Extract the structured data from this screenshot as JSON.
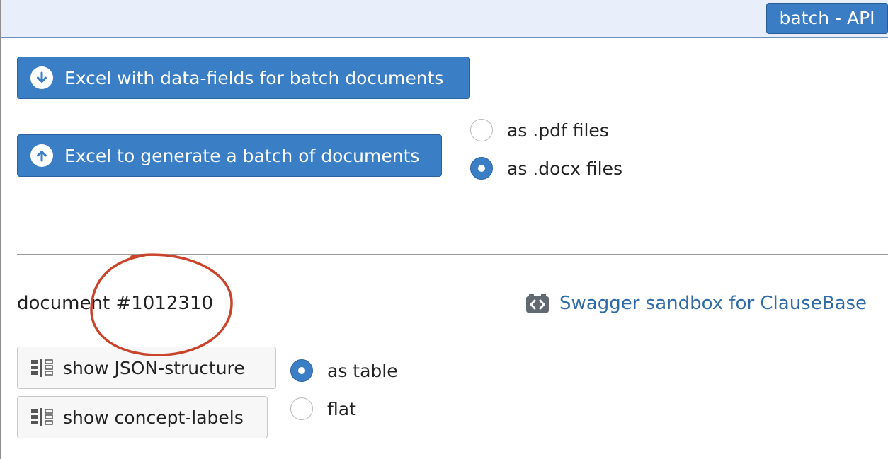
{
  "header": {
    "tab_label": "batch - API"
  },
  "batch": {
    "download_button_label": "Excel with data-fields for batch documents",
    "upload_button_label": "Excel to generate a batch of documents",
    "format_options": [
      {
        "label": "as .pdf files",
        "checked": false
      },
      {
        "label": "as .docx files",
        "checked": true
      }
    ]
  },
  "document": {
    "label": "document #1012310",
    "swagger_link": "Swagger sandbox for ClauseBase",
    "json_button_label": "show JSON-structure",
    "concept_button_label": "show concept-labels",
    "view_options": [
      {
        "label": "as table",
        "checked": true
      },
      {
        "label": "flat",
        "checked": false
      }
    ]
  },
  "colors": {
    "accent": "#3a7ec6",
    "header_bg": "#e8eefa",
    "link": "#2f6ca7",
    "annotation": "#c9442a"
  },
  "icons": [
    "arrow-down-circle-icon",
    "arrow-up-circle-icon",
    "code-icon",
    "columns-icon"
  ]
}
